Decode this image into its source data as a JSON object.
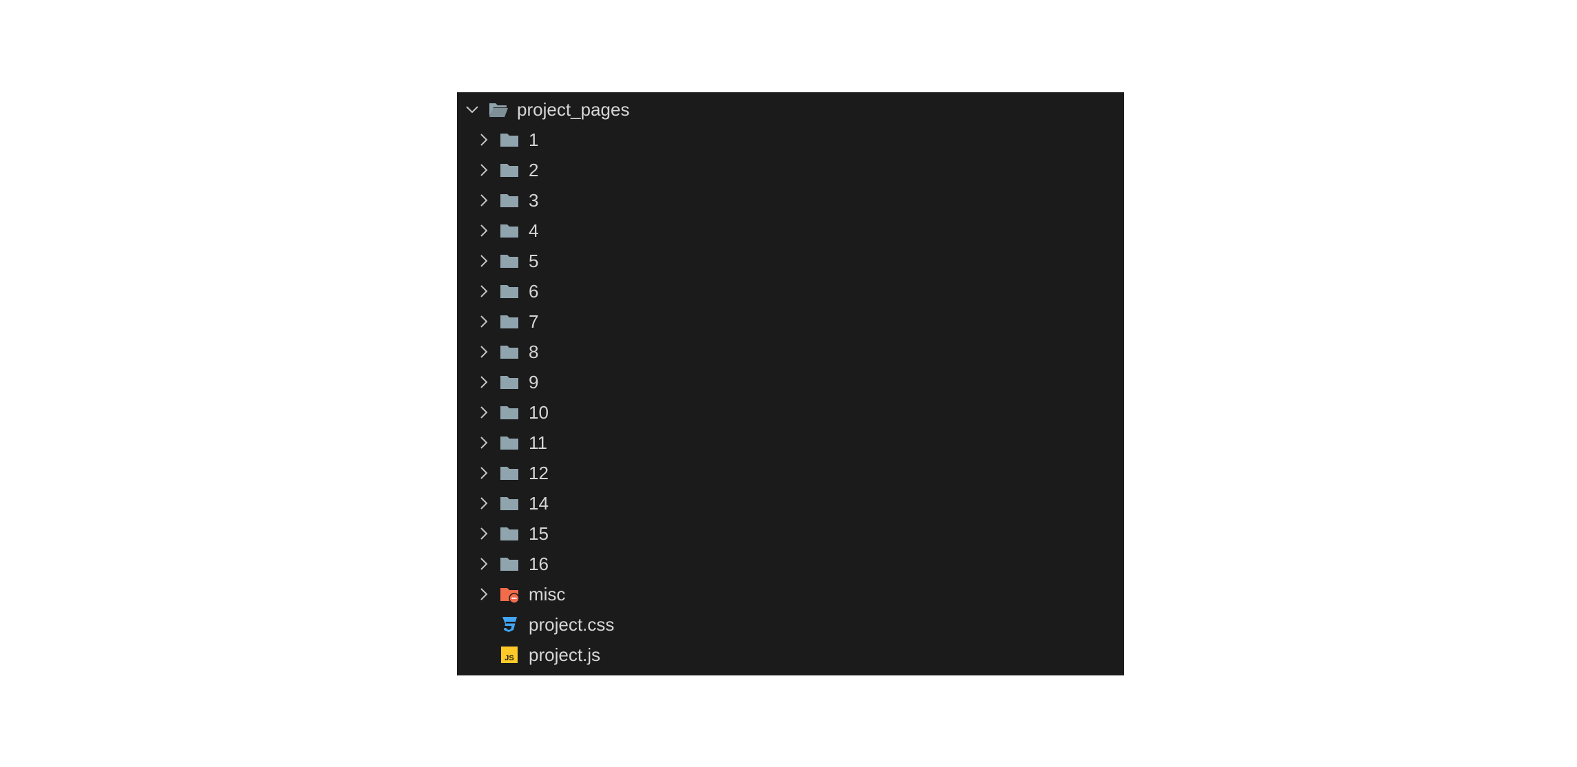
{
  "explorer": {
    "root": {
      "label": "project_pages",
      "icon": "folder-open-icon",
      "expanded": true
    },
    "items": [
      {
        "label": "1",
        "type": "folder",
        "icon": "folder-icon"
      },
      {
        "label": "2",
        "type": "folder",
        "icon": "folder-icon"
      },
      {
        "label": "3",
        "type": "folder",
        "icon": "folder-icon"
      },
      {
        "label": "4",
        "type": "folder",
        "icon": "folder-icon"
      },
      {
        "label": "5",
        "type": "folder",
        "icon": "folder-icon"
      },
      {
        "label": "6",
        "type": "folder",
        "icon": "folder-icon"
      },
      {
        "label": "7",
        "type": "folder",
        "icon": "folder-icon"
      },
      {
        "label": "8",
        "type": "folder",
        "icon": "folder-icon"
      },
      {
        "label": "9",
        "type": "folder",
        "icon": "folder-icon"
      },
      {
        "label": "10",
        "type": "folder",
        "icon": "folder-icon"
      },
      {
        "label": "11",
        "type": "folder",
        "icon": "folder-icon"
      },
      {
        "label": "12",
        "type": "folder",
        "icon": "folder-icon"
      },
      {
        "label": "14",
        "type": "folder",
        "icon": "folder-icon"
      },
      {
        "label": "15",
        "type": "folder",
        "icon": "folder-icon"
      },
      {
        "label": "16",
        "type": "folder",
        "icon": "folder-icon"
      },
      {
        "label": "misc",
        "type": "folder",
        "icon": "misc-folder-icon"
      },
      {
        "label": "project.css",
        "type": "file",
        "icon": "css-file-icon"
      },
      {
        "label": "project.js",
        "type": "file",
        "icon": "js-file-icon"
      }
    ]
  },
  "colors": {
    "panel_bg": "#1b1b1b",
    "text": "#d6d6d6",
    "chevron": "#c5c5c5",
    "folder": "#90a4ae",
    "misc_folder": "#f26b4a",
    "css_icon": "#42a5f5",
    "js_icon": "#ffca28"
  }
}
